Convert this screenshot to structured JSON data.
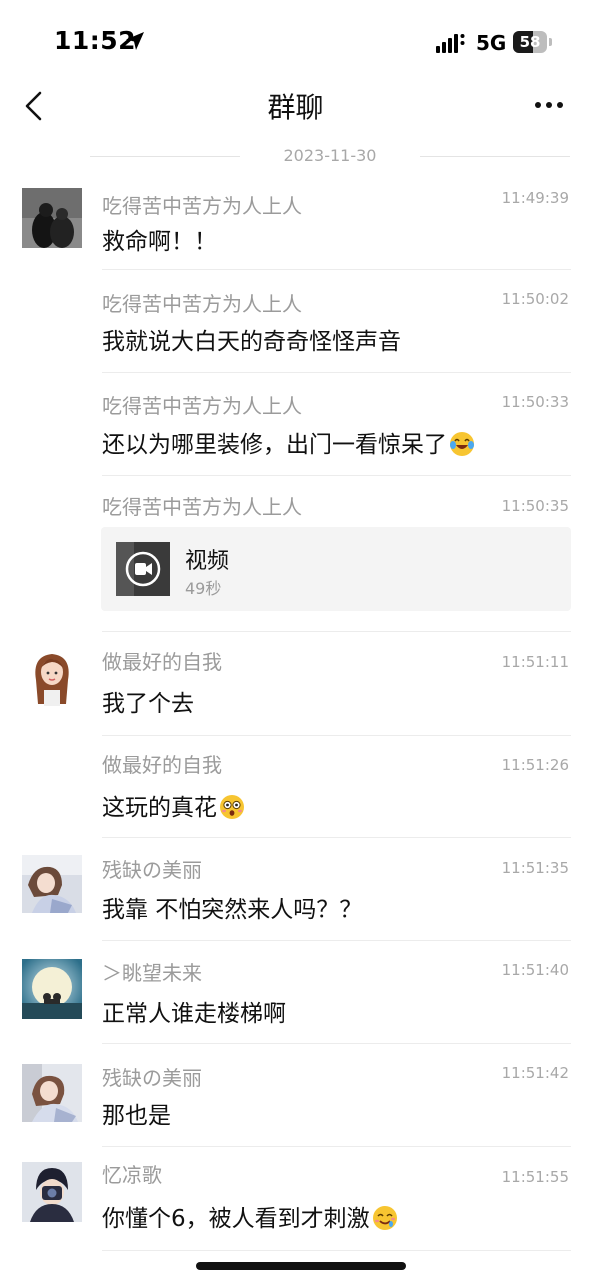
{
  "status_bar": {
    "time": "11:52",
    "network": "5G",
    "battery": "58",
    "battery_level": 0.58
  },
  "nav": {
    "title": "群聊"
  },
  "date_divider": "2023-11-30",
  "messages": [
    {
      "sender": "吃得苦中苦方为人上人",
      "time": "11:49:39",
      "text": "救命啊！！"
    },
    {
      "sender": "吃得苦中苦方为人上人",
      "time": "11:50:02",
      "text": "我就说大白天的奇奇怪怪声音"
    },
    {
      "sender": "吃得苦中苦方为人上人",
      "time": "11:50:33",
      "text": "还以为哪里装修，出门一看惊呆了",
      "emoji": "crying-laughing-emoji"
    },
    {
      "sender": "吃得苦中苦方为人上人",
      "time": "11:50:35",
      "video_label": "视频",
      "video_duration": "49秒"
    },
    {
      "sender": "做最好的自我",
      "time": "11:51:11",
      "text": "我了个去"
    },
    {
      "sender": "做最好的自我",
      "time": "11:51:26",
      "text": "这玩的真花",
      "emoji": "astonished-emoji"
    },
    {
      "sender": "残缺の美丽",
      "time": "11:51:35",
      "text": "我靠 不怕突然来人吗？？"
    },
    {
      "sender": "＞眺望未来",
      "time": "11:51:40",
      "text": "正常人谁走楼梯啊"
    },
    {
      "sender": "残缺の美丽",
      "time": "11:51:42",
      "text": "那也是"
    },
    {
      "sender": "忆凉歌",
      "time": "11:51:55",
      "text": "你懂个6，被人看到才刺激",
      "emoji": "drooling-face-emoji"
    }
  ]
}
